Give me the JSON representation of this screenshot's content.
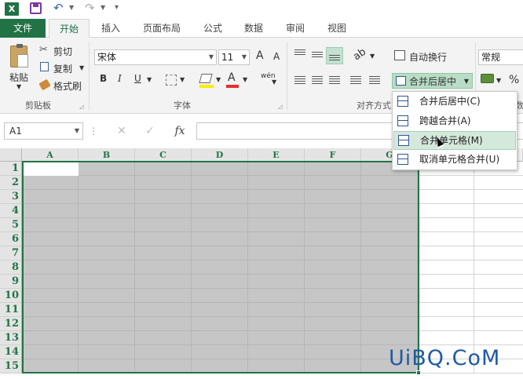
{
  "app": {
    "logo_letter": "X"
  },
  "qat": {
    "undo_icon": "undo-icon",
    "redo_icon": "redo-icon",
    "customize": "▾"
  },
  "tabs": [
    {
      "label": "文件"
    },
    {
      "label": "开始"
    },
    {
      "label": "插入"
    },
    {
      "label": "页面布局"
    },
    {
      "label": "公式"
    },
    {
      "label": "数据"
    },
    {
      "label": "审阅"
    },
    {
      "label": "视图"
    }
  ],
  "clipboard": {
    "paste": "粘贴",
    "cut": "剪切",
    "copy": "复制",
    "format_painter": "格式刷",
    "group": "剪贴板"
  },
  "font": {
    "name": "宋体",
    "size": "11",
    "bold": "B",
    "italic": "I",
    "underline": "U",
    "grow": "A",
    "shrink": "A",
    "font_color": "A",
    "phonetic": "wén",
    "group": "字体"
  },
  "alignment": {
    "wrap": "自动换行",
    "merge": "合并后居中",
    "group": "对齐方式"
  },
  "number": {
    "format": "常规",
    "percent": "%",
    "group": "数"
  },
  "formula_bar": {
    "name_box": "A1",
    "cancel": "✕",
    "enter": "✓",
    "fx": "fx"
  },
  "columns": [
    "A",
    "B",
    "C",
    "D",
    "E",
    "F",
    "G"
  ],
  "rows": [
    "1",
    "2",
    "3",
    "4",
    "5",
    "6",
    "7",
    "8",
    "9",
    "10",
    "11",
    "12",
    "13",
    "14",
    "15"
  ],
  "merge_menu": [
    {
      "label": "合并后居中(C)",
      "icon": "merge-center-icon"
    },
    {
      "label": "跨越合并(A)",
      "icon": "merge-across-icon"
    },
    {
      "label": "合并单元格(M)",
      "icon": "merge-cells-icon",
      "highlighted": true
    },
    {
      "label": "取消单元格合并(U)",
      "icon": "unmerge-icon"
    }
  ],
  "watermark": "UiBQ.CoM",
  "colors": {
    "excel_green": "#217346",
    "selection": "#c6c6c6",
    "menu_highlight": "#d5e8dc"
  }
}
